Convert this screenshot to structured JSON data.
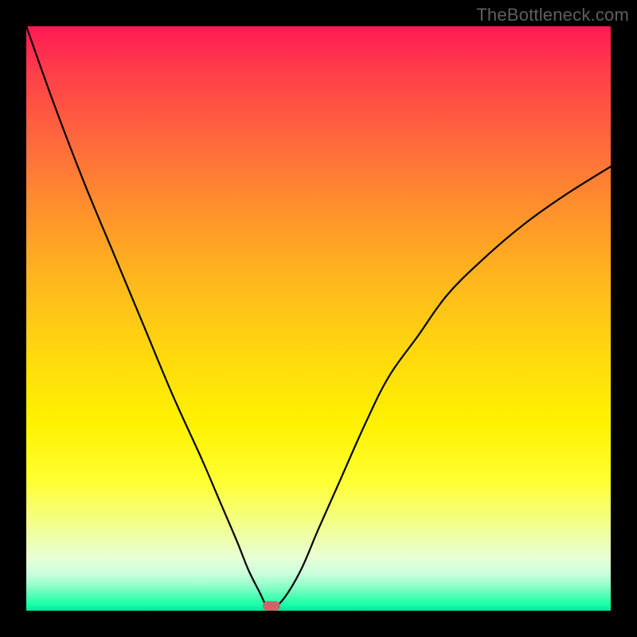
{
  "watermark": {
    "text": "TheBottleneck.com"
  },
  "colors": {
    "frame": "#000000",
    "curve": "#000000",
    "marker": "#cc6666",
    "gradient_stops": [
      {
        "pos": 0,
        "color": "#ff1a55"
      },
      {
        "pos": 0.2,
        "color": "#ff6a3c"
      },
      {
        "pos": 0.42,
        "color": "#ffb31f"
      },
      {
        "pos": 0.68,
        "color": "#fff200"
      },
      {
        "pos": 0.88,
        "color": "#edffb0"
      },
      {
        "pos": 0.96,
        "color": "#99ffcc"
      },
      {
        "pos": 1.0,
        "color": "#00e69a"
      }
    ]
  },
  "chart_data": {
    "type": "line",
    "title": "",
    "xlabel": "",
    "ylabel": "",
    "xlim": [
      0,
      100
    ],
    "ylim": [
      0,
      100
    ],
    "note": "V-shaped bottleneck curve. Single series; y is bottleneck percentage, x is a normalized position. Values estimated from pixel positions relative to the plot area.",
    "x": [
      0,
      5,
      10,
      15,
      20,
      25,
      30,
      33,
      36,
      38,
      40,
      41,
      42,
      44,
      47,
      50,
      54,
      58,
      62,
      67,
      72,
      78,
      85,
      92,
      100
    ],
    "y": [
      100,
      86,
      73,
      61,
      49,
      37,
      26,
      19,
      12,
      7,
      3,
      1,
      0.5,
      2,
      7,
      14,
      23,
      32,
      40,
      47,
      54,
      60,
      66,
      71,
      76
    ],
    "minimum": {
      "x": 42,
      "y": 0.5
    },
    "marker": {
      "x": 42,
      "y": 0.5,
      "label": "optimal-point"
    }
  }
}
